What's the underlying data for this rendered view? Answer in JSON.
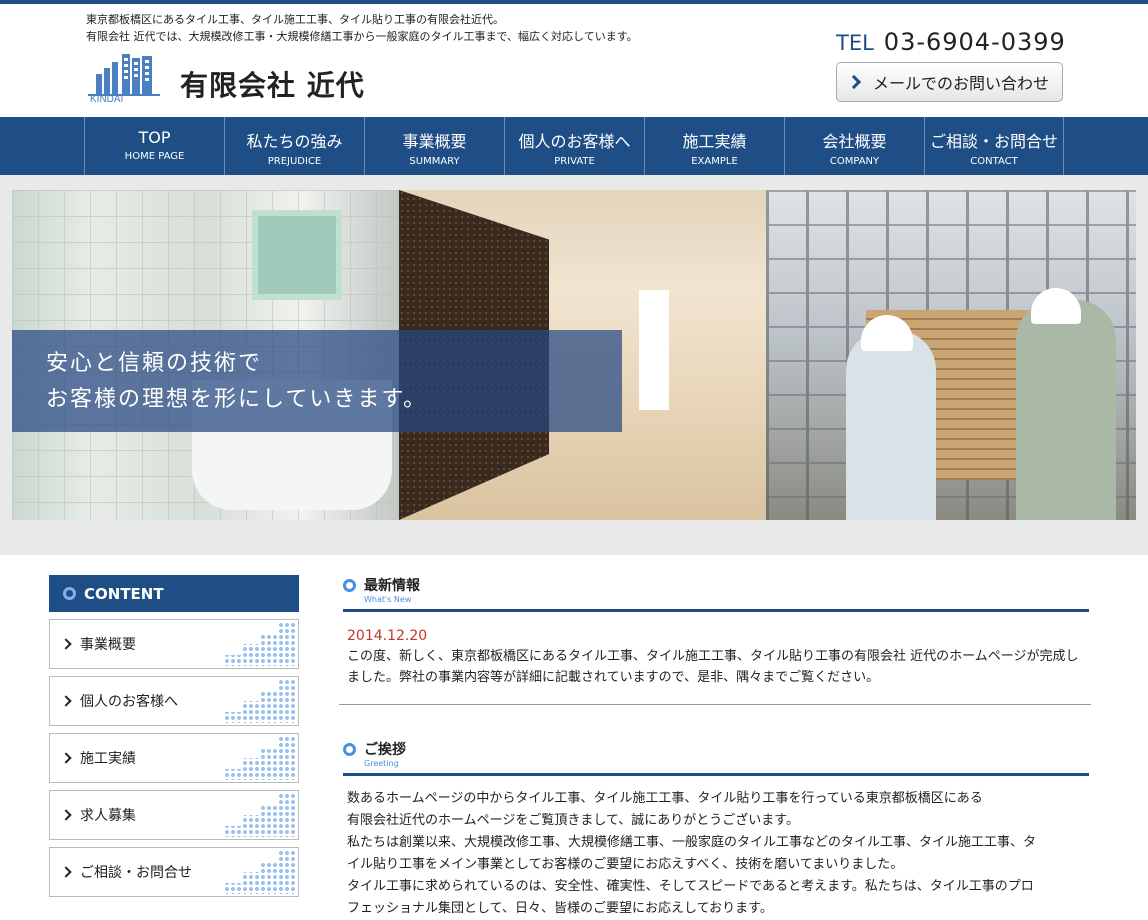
{
  "header": {
    "intro_line1": "東京都板橋区にあるタイル工事、タイル施工工事、タイル貼り工事の有限会社近代。",
    "intro_line2": "有限会社 近代では、大規模改修工事・大規模修繕工事から一般家庭のタイル工事まで、幅広く対応しています。",
    "logo_text": "KINDAI",
    "company_name": "有限会社 近代",
    "tel_label": "TEL",
    "tel_number": "03-6904-0399",
    "mail_button": "メールでのお問い合わせ"
  },
  "nav": [
    {
      "jp": "TOP",
      "en": "HOME PAGE"
    },
    {
      "jp": "私たちの強み",
      "en": "PREJUDICE"
    },
    {
      "jp": "事業概要",
      "en": "SUMMARY"
    },
    {
      "jp": "個人のお客様へ",
      "en": "PRIVATE"
    },
    {
      "jp": "施工実績",
      "en": "EXAMPLE"
    },
    {
      "jp": "会社概要",
      "en": "COMPANY"
    },
    {
      "jp": "ご相談・お問合せ",
      "en": "CONTACT"
    }
  ],
  "hero": {
    "catch_line1": "安心と信頼の技術で",
    "catch_line2": "お客様の理想を形にしていきます。"
  },
  "sidebar": {
    "heading": "CONTENT",
    "items": [
      {
        "label": "事業概要"
      },
      {
        "label": "個人のお客様へ"
      },
      {
        "label": "施工実績"
      },
      {
        "label": "求人募集"
      },
      {
        "label": "ご相談・お問合せ"
      }
    ]
  },
  "news": {
    "title": "最新情報",
    "subtitle": "What's New",
    "date": "2014.12.20",
    "text": "この度、新しく、東京都板橋区にあるタイル工事、タイル施工工事、タイル貼り工事の有限会社 近代のホームページが完成しました。弊社の事業内容等が詳細に記載されていますので、是非、隅々までご覧ください。"
  },
  "greeting": {
    "title": "ご挨拶",
    "subtitle": "Greeting",
    "lines": [
      "数あるホームページの中からタイル工事、タイル施工工事、タイル貼り工事を行っている東京都板橋区にある",
      "有限会社近代のホームページをご覧頂きまして、誠にありがとうございます。",
      "私たちは創業以来、大規模改修工事、大規模修繕工事、一般家庭のタイル工事などのタイル工事、タイル施工工事、タ",
      "イル貼り工事をメイン事業としてお客様のご要望にお応えすべく、技術を磨いてまいりました。",
      "タイル工事に求められているのは、安全性、確実性、そしてスピードであると考えます。私たちは、タイル工事のプロ",
      "フェッショナル集団として、日々、皆様のご要望にお応えしております。"
    ]
  },
  "colors": {
    "brand": "#1f4e86",
    "accent": "#4a8fe0",
    "date": "#c0392b"
  }
}
